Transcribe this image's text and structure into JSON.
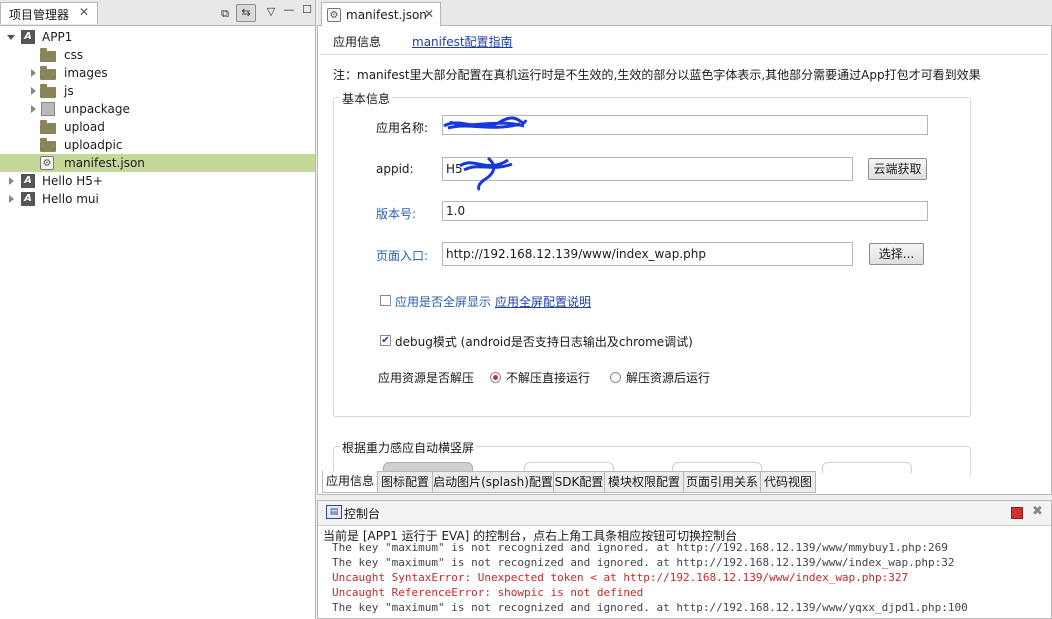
{
  "project_explorer": {
    "tab_label": "项目管理器",
    "tree": [
      {
        "label": "APP1",
        "kind": "project",
        "expanded": true,
        "level": 0
      },
      {
        "label": "css",
        "kind": "folder",
        "expanded": false,
        "level": 1,
        "has_children": false
      },
      {
        "label": "images",
        "kind": "folder",
        "expanded": false,
        "level": 1,
        "has_children": true
      },
      {
        "label": "js",
        "kind": "folder",
        "expanded": false,
        "level": 1,
        "has_children": true
      },
      {
        "label": "unpackage",
        "kind": "package",
        "expanded": false,
        "level": 1,
        "has_children": true
      },
      {
        "label": "upload",
        "kind": "folder",
        "expanded": false,
        "level": 1,
        "has_children": false
      },
      {
        "label": "uploadpic",
        "kind": "folder",
        "expanded": false,
        "level": 1,
        "has_children": false
      },
      {
        "label": "manifest.json",
        "kind": "file",
        "expanded": false,
        "level": 1,
        "has_children": false,
        "selected": true
      },
      {
        "label": "Hello H5+",
        "kind": "project",
        "expanded": false,
        "level": 0,
        "has_children": true
      },
      {
        "label": "Hello mui",
        "kind": "project",
        "expanded": false,
        "level": 0,
        "has_children": true
      }
    ]
  },
  "editor": {
    "tab_label": "manifest.json",
    "header": {
      "app_info": "应用信息",
      "config_guide_link": "manifest配置指南"
    },
    "notice": "注：manifest里大部分配置在真机运行时是不生效的,生效的部分以蓝色字体表示,其他部分需要通过App打包才可看到效果",
    "basic_group_title": "基本信息",
    "app_name_label": "应用名称:",
    "app_name_value": "",
    "appid_label": "appid:",
    "appid_value": "H5",
    "cloud_button": "云端获取",
    "version_label": "版本号:",
    "version_value": "1.0",
    "entry_label": "页面入口:",
    "entry_value": "http://192.168.12.139/www/index_wap.php",
    "choose_button": "选择...",
    "fullscreen_label": "应用是否全屏显示",
    "fullscreen_checked": false,
    "fullscreen_link": "应用全屏配置说明",
    "debug_label": "debug模式 (android是否支持日志输出及chrome调试)",
    "debug_checked": true,
    "unzip_label": "应用资源是否解压",
    "unzip_options": [
      "不解压直接运行",
      "解压资源后运行"
    ],
    "unzip_selected": 0,
    "gravity_group_title": "根据重力感应自动横竖屏",
    "bottom_tabs": [
      "应用信息",
      "图标配置",
      "启动图片(splash)配置",
      "SDK配置",
      "模块权限配置",
      "页面引用关系",
      "代码视图"
    ],
    "bottom_tab_active": 0
  },
  "console": {
    "tab_label": "控制台",
    "status": "当前是 [APP1 运行于 EVA] 的控制台，点右上角工具条相应按钮可切换控制台",
    "lines": [
      {
        "text": "The key \"maximum\" is not recognized and ignored. at http://192.168.12.139/www/mmybuy1.php:269",
        "error": false
      },
      {
        "text": "The key \"maximum\" is not recognized and ignored. at http://192.168.12.139/www/index_wap.php:32",
        "error": false
      },
      {
        "text": "Uncaught SyntaxError: Unexpected token < at http://192.168.12.139/www/index_wap.php:327",
        "error": true
      },
      {
        "text": "Uncaught ReferenceError: showpic is not defined",
        "error": true
      },
      {
        "text": "The key \"maximum\" is not recognized and ignored. at http://192.168.12.139/www/yqxx_djpd1.php:100",
        "error": false
      }
    ]
  },
  "colors": {
    "selection": "#c4d899",
    "link": "#1f3fa8",
    "blue_label": "#2a5db0",
    "error_text": "#c62828",
    "console_text": "#444444"
  }
}
